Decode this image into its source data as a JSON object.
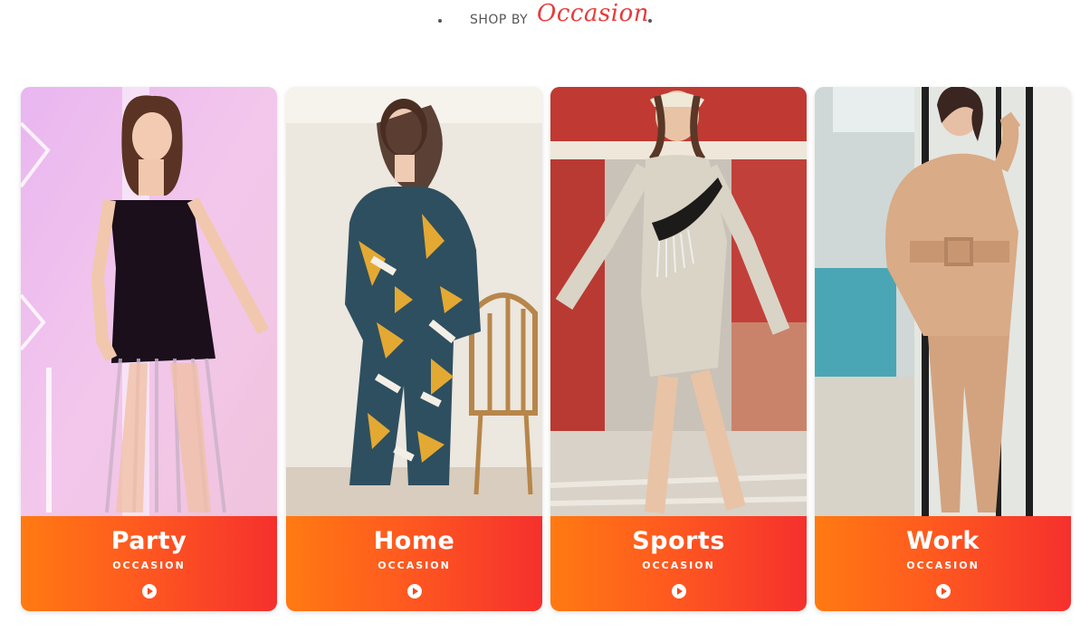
{
  "header": {
    "prefix": "SHOP BY",
    "title": "Occasion"
  },
  "cards": [
    {
      "name": "Party",
      "sub": "OCCASION"
    },
    {
      "name": "Home",
      "sub": "OCCASION"
    },
    {
      "name": "Sports",
      "sub": "OCCASION"
    },
    {
      "name": "Work",
      "sub": "OCCASION"
    }
  ],
  "colors": {
    "accent": "#e83a3a",
    "banner_start": "#ff7a12",
    "banner_end": "#f5302d"
  },
  "icons": [
    "play-icon"
  ]
}
